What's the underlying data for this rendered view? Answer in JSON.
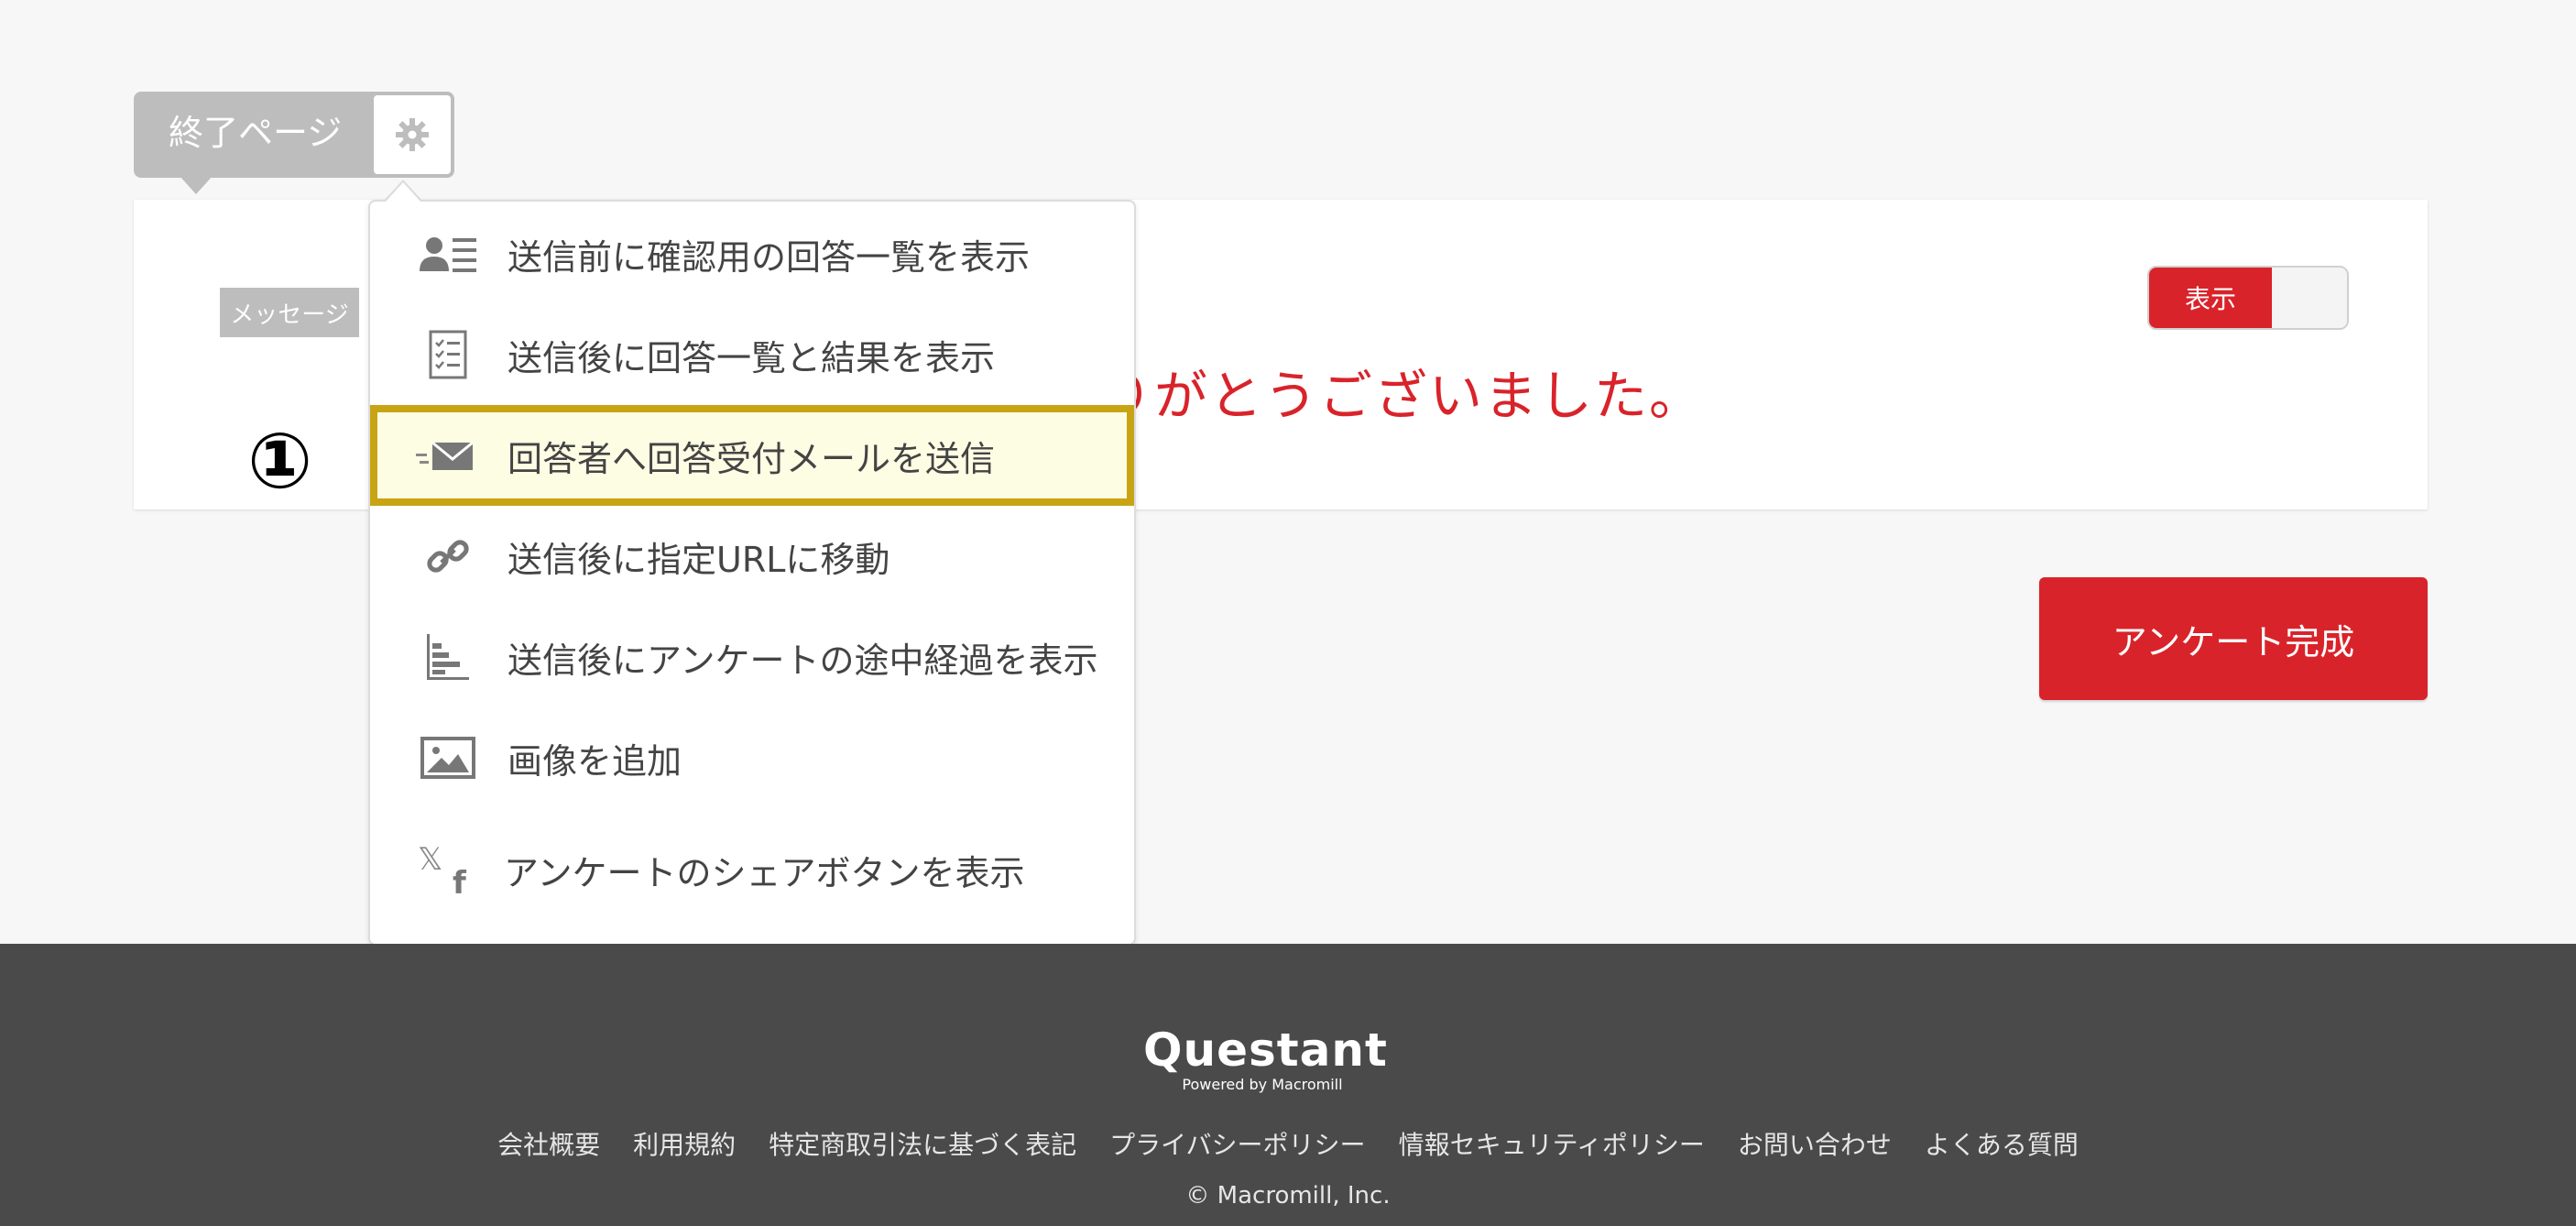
{
  "page_tab": {
    "label": "終了ページ",
    "settings_icon": "gear-icon"
  },
  "card": {
    "message_tag": "メッセージ",
    "thanks_text_visible": "りがとうございました。",
    "toggle_label": "表示"
  },
  "complete_button": "アンケート完成",
  "menu": {
    "items": [
      {
        "icon": "user-list-icon",
        "label": "送信前に確認用の回答一覧を表示"
      },
      {
        "icon": "checklist-icon",
        "label": "送信後に回答一覧と結果を表示"
      },
      {
        "icon": "mail-send-icon",
        "label": "回答者へ回答受付メールを送信",
        "highlighted": true
      },
      {
        "icon": "link-icon",
        "label": "送信後に指定URLに移動"
      },
      {
        "icon": "bar-chart-icon",
        "label": "送信後にアンケートの途中経過を表示"
      },
      {
        "icon": "image-icon",
        "label": "画像を追加"
      },
      {
        "icon": "x-facebook-icon",
        "label": "アンケートのシェアボタンを表示"
      }
    ]
  },
  "marker": "①",
  "footer": {
    "logo": "Questant",
    "logo_sub": "Powered by Macromill",
    "links": [
      "会社概要",
      "利用規約",
      "特定商取引法に基づく表記",
      "プライバシーポリシー",
      "情報セキュリティポリシー",
      "お問い合わせ",
      "よくある質問"
    ],
    "copyright": "© Macromill, Inc."
  },
  "colors": {
    "accent": "#d9232a",
    "highlight_border": "#c8a414",
    "highlight_fill": "#fdfde4",
    "footer_bg": "#4a4a4a"
  }
}
